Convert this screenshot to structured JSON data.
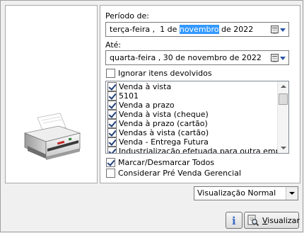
{
  "period": {
    "from_label": "Período de:",
    "from_weekday": "terça-feira",
    "from_sep": " ,",
    "from_day": "1 de",
    "from_month": "novembro",
    "from_year": "de 2022",
    "to_label": "Até:",
    "to_value": "quarta-feira , 30 de novembro de 2022"
  },
  "ignore_returns": {
    "label": "Ignorar itens devolvidos",
    "checked": false
  },
  "list": {
    "items": [
      {
        "label": "Venda à vista",
        "checked": true
      },
      {
        "label": "5101",
        "checked": true
      },
      {
        "label": "Venda a prazo",
        "checked": true
      },
      {
        "label": "Venda à vista (cheque)",
        "checked": true
      },
      {
        "label": "Venda à prazo (cartão)",
        "checked": true
      },
      {
        "label": "Vendas à vista (cartão)",
        "checked": true
      },
      {
        "label": "Venda - Entrega Futura",
        "checked": true
      },
      {
        "label": "Industrialização efetuada para outra empresa",
        "checked": true
      }
    ]
  },
  "toggle_all": {
    "label": "Marcar/Desmarcar Todos",
    "checked": true
  },
  "pre_sale": {
    "label": "Considerar Pré Venda Gerencial",
    "checked": false
  },
  "view_mode": {
    "selected": "Visualização Normal"
  },
  "buttons": {
    "info": "i",
    "view_prefix": "V",
    "view_rest": "isualizar"
  },
  "icons": {
    "calendar": "calendar-icon",
    "printer": "printer-icon",
    "preview": "document-preview-icon"
  },
  "colors": {
    "selection": "#3399ff",
    "accent": "#2a54a4"
  }
}
